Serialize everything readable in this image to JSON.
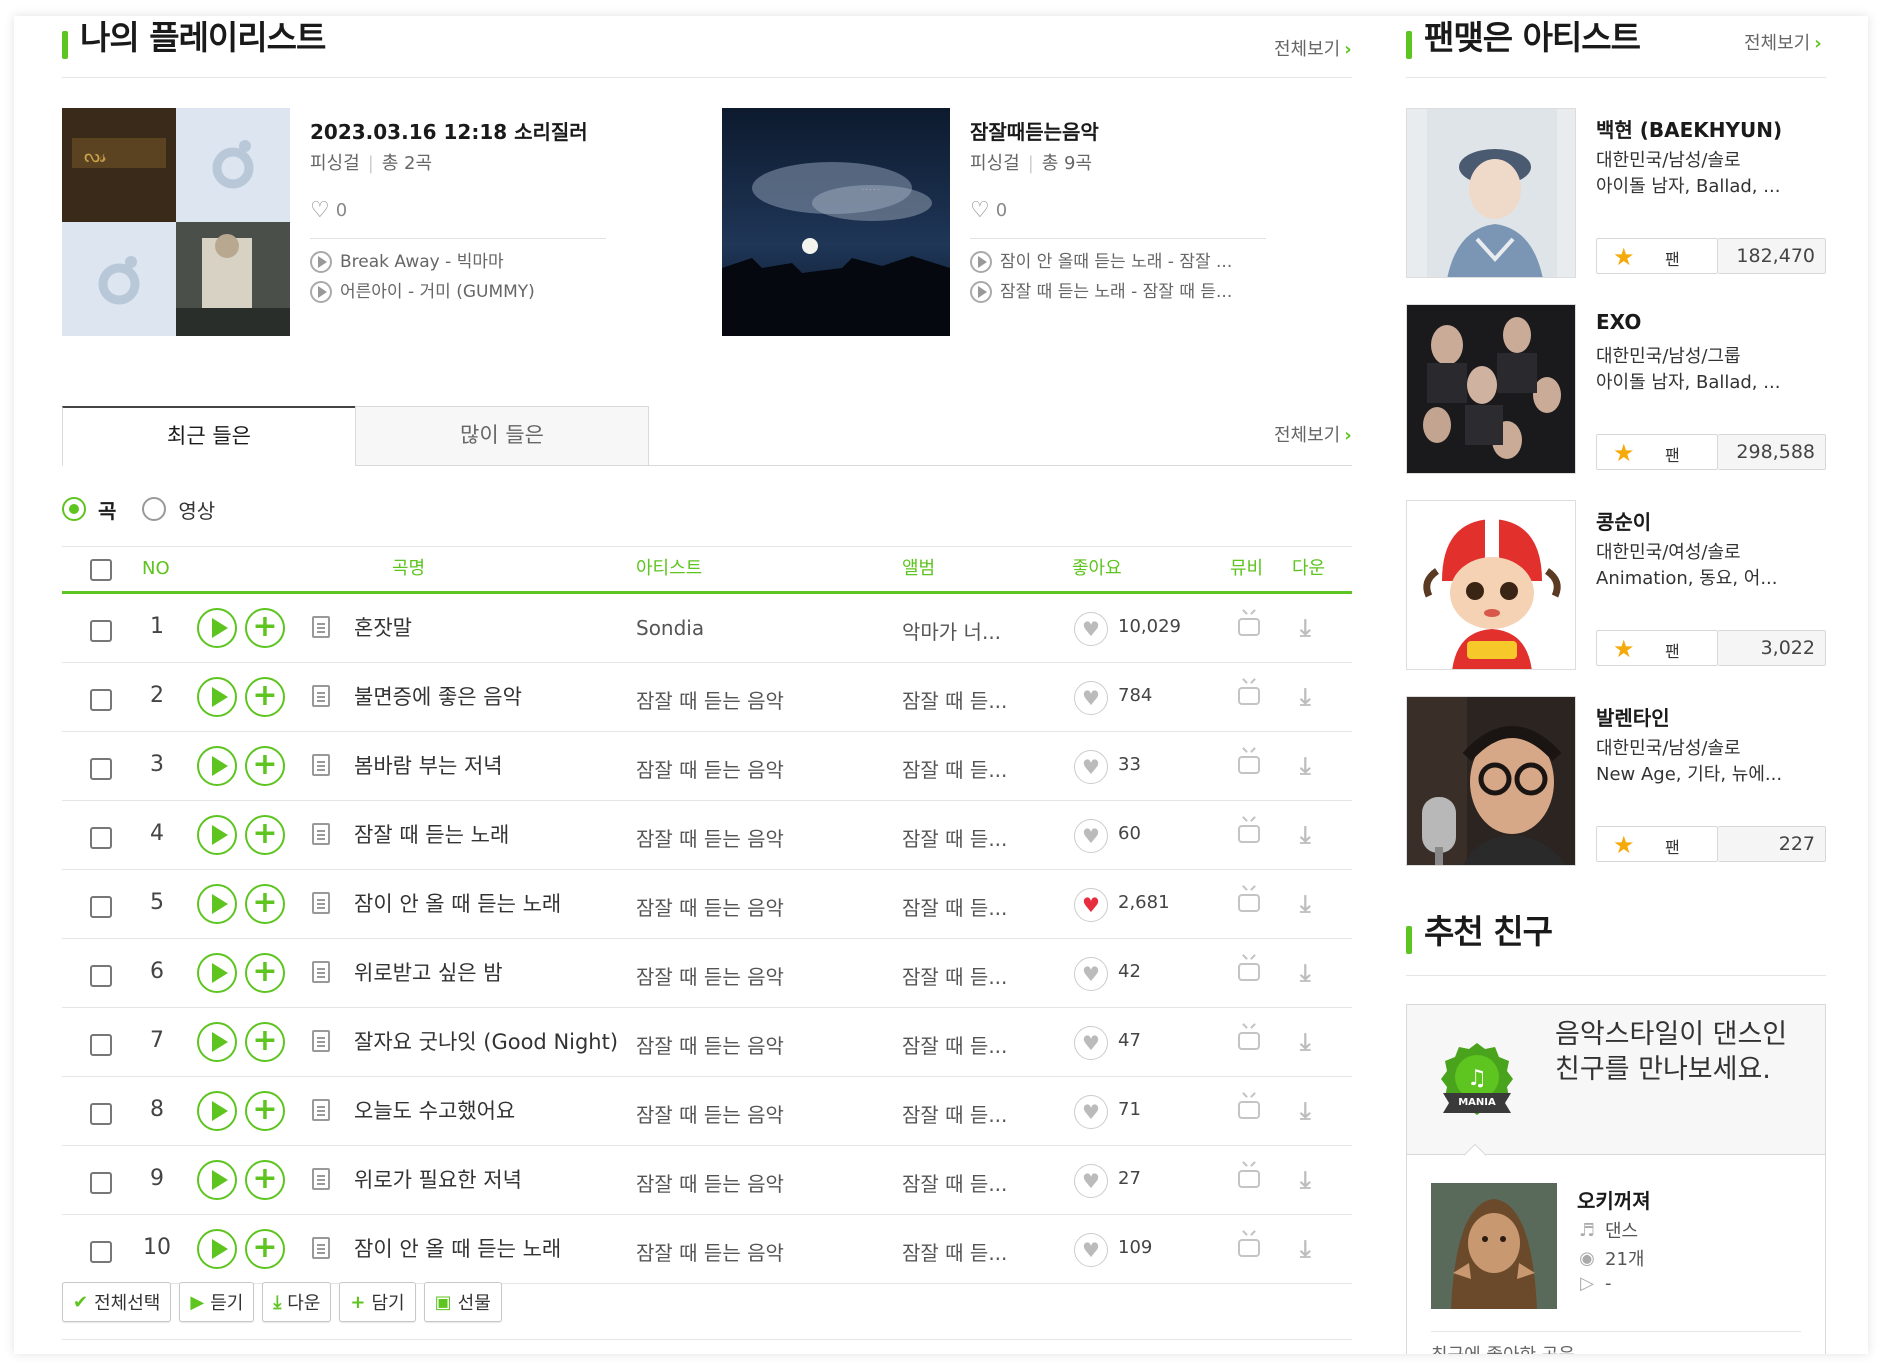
{
  "playlist_section": {
    "title": "나의 플레이리스트",
    "see_all": "전체보기",
    "playlists": [
      {
        "title": "2023.03.16 12:18 소리질러",
        "owner": "피싱걸",
        "count": "총 2곡",
        "likes": "0",
        "songs": [
          {
            "title": "Break Away",
            "artist": "빅마마"
          },
          {
            "title": "어른아이",
            "artist": "거미 (GUMMY)"
          }
        ]
      },
      {
        "title": "잠잘때듣는음악",
        "owner": "피싱걸",
        "count": "총 9곡",
        "likes": "0",
        "songs": [
          {
            "title": "잠이 안 올때 듣는 노래",
            "artist": "잠잘 ..."
          },
          {
            "title": "잠잘 때 듣는 노래",
            "artist": "잠잘 때 듣..."
          }
        ]
      }
    ]
  },
  "tabs": {
    "recent": "최근 들은",
    "most": "많이 들은",
    "see_all": "전체보기"
  },
  "filter": {
    "song": "곡",
    "video": "영상",
    "selected": "곡"
  },
  "table": {
    "headers": {
      "no": "NO",
      "title": "곡명",
      "artist": "아티스트",
      "album": "앨범",
      "like": "좋아요",
      "mv": "뮤비",
      "down": "다운"
    },
    "rows": [
      {
        "no": "1",
        "title": "혼잣말",
        "artist": "Sondia",
        "album": "악마가 너...",
        "likes": "10,029",
        "liked": false
      },
      {
        "no": "2",
        "title": "불면증에 좋은 음악",
        "artist": "잠잘 때 듣는 음악",
        "album": "잠잘 때 듣...",
        "likes": "784",
        "liked": false
      },
      {
        "no": "3",
        "title": "봄바람 부는 저녁",
        "artist": "잠잘 때 듣는 음악",
        "album": "잠잘 때 듣...",
        "likes": "33",
        "liked": false
      },
      {
        "no": "4",
        "title": "잠잘 때 듣는 노래",
        "artist": "잠잘 때 듣는 음악",
        "album": "잠잘 때 듣...",
        "likes": "60",
        "liked": false
      },
      {
        "no": "5",
        "title": "잠이 안 올 때 듣는 노래",
        "artist": "잠잘 때 듣는 음악",
        "album": "잠잘 때 듣...",
        "likes": "2,681",
        "liked": true
      },
      {
        "no": "6",
        "title": "위로받고 싶은 밤",
        "artist": "잠잘 때 듣는 음악",
        "album": "잠잘 때 듣...",
        "likes": "42",
        "liked": false
      },
      {
        "no": "7",
        "title": "잘자요 굿나잇 (Good Night)",
        "artist": "잠잘 때 듣는 음악",
        "album": "잠잘 때 듣...",
        "likes": "47",
        "liked": false
      },
      {
        "no": "8",
        "title": "오늘도 수고했어요",
        "artist": "잠잘 때 듣는 음악",
        "album": "잠잘 때 듣...",
        "likes": "71",
        "liked": false
      },
      {
        "no": "9",
        "title": "위로가 필요한 저녁",
        "artist": "잠잘 때 듣는 음악",
        "album": "잠잘 때 듣...",
        "likes": "27",
        "liked": false
      },
      {
        "no": "10",
        "title": "잠이 안 올 때 듣는 노래",
        "artist": "잠잘 때 듣는 음악",
        "album": "잠잘 때 듣...",
        "likes": "109",
        "liked": false
      }
    ]
  },
  "bottom_buttons": {
    "select_all": "전체선택",
    "listen": "듣기",
    "download": "다운",
    "add": "담기",
    "gift": "선물"
  },
  "fan_section": {
    "title": "팬맺은 아티스트",
    "see_all": "전체보기",
    "fan_label": "팬",
    "artists": [
      {
        "name": "백현 (BAEKHYUN)",
        "info1": "대한민국/남성/솔로",
        "info2": "아이돌 남자, Ballad, ...",
        "fans": "182,470"
      },
      {
        "name": "EXO",
        "info1": "대한민국/남성/그룹",
        "info2": "아이돌 남자, Ballad, ...",
        "fans": "298,588"
      },
      {
        "name": "콩순이",
        "info1": "대한민국/여성/솔로",
        "info2": "Animation, 동요, 어...",
        "fans": "3,022"
      },
      {
        "name": "발렌타인",
        "info1": "대한민국/남성/솔로",
        "info2": "New Age, 기타, 뉴에...",
        "fans": "227"
      }
    ]
  },
  "friend_section": {
    "title": "추천 친구",
    "banner": "음악스타일이 댄스인 친구를 만나보세요.",
    "badge": "MANIA",
    "friend": {
      "name": "오키꺼져",
      "genre": "댄스",
      "count": "21개",
      "playing": "-"
    },
    "more": "최근에 좋아한 곡음..."
  },
  "colors": {
    "accent": "#5ec41f",
    "star": "#f5a90a",
    "heart_red": "#e62e3f"
  }
}
